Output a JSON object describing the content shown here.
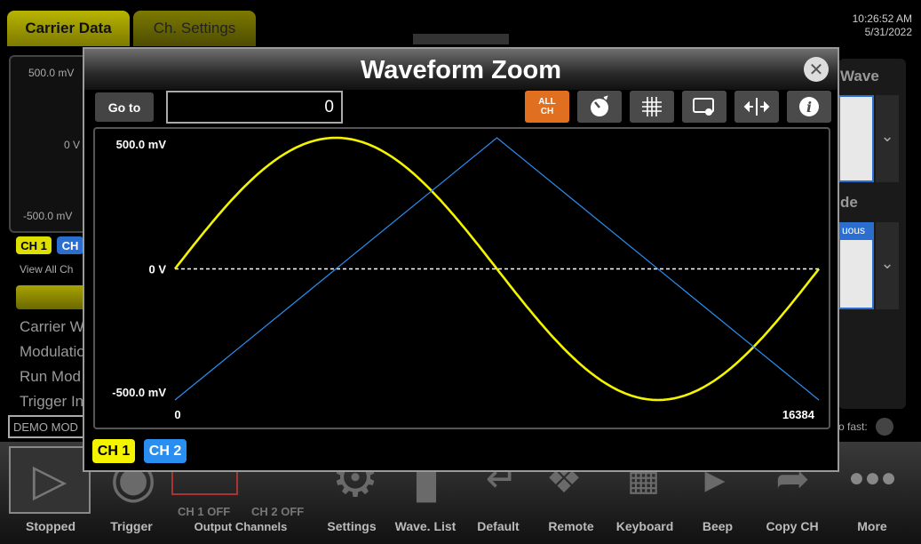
{
  "app": {
    "tabs": [
      "Carrier Data",
      "Ch. Settings"
    ],
    "clock_time": "10:26:52 AM",
    "clock_date": "5/31/2022",
    "left_panel": {
      "top_label": "500.0 mV",
      "mid_label": "0 V",
      "bottom_label": "-500.0 mV"
    },
    "left_chips": [
      "CH 1",
      "CH"
    ],
    "view_all": "View All Ch",
    "menu_items": [
      "Carrier W",
      "Modulatio",
      "Run Mod",
      "Trigger In"
    ],
    "demo_mode": "DEMO MOD",
    "right_labels": {
      "wave": "Wave",
      "mode": "de",
      "mode_value": "uous",
      "auto_fast": "o fast:"
    },
    "toolbar": {
      "labels": [
        "Stopped",
        "Trigger",
        "Output Channels",
        "Settings",
        "Wave. List",
        "Default",
        "Remote",
        "Keyboard",
        "Beep",
        "Copy CH",
        "More"
      ],
      "ch1_off": "CH 1 OFF",
      "ch2_off": "CH 2 OFF"
    }
  },
  "modal": {
    "title": "Waveform Zoom",
    "goto_label": "Go to",
    "goto_value": "0",
    "all_ch_line1": "ALL",
    "all_ch_line2": "CH",
    "icons": [
      "speed-dial-icon",
      "grid-icon",
      "touch-select-icon",
      "pan-horizontal-icon",
      "info-icon"
    ],
    "channels": [
      "CH 1",
      "CH 2"
    ],
    "colors": {
      "ch1": "#f4f400",
      "ch2": "#2a8ef0",
      "all_ch": "#e07020"
    }
  },
  "chart_data": {
    "type": "line",
    "y_labels": {
      "top": "500.0 mV",
      "zero": "0 V",
      "bottom": "-500.0 mV"
    },
    "x_labels": {
      "start": "0",
      "end": "16384"
    },
    "xlim": [
      0,
      16384
    ],
    "ylim": [
      -500,
      500
    ],
    "zero_line": "dashed",
    "series": [
      {
        "name": "CH 1",
        "color": "#f4f400",
        "shape": "sine",
        "x": [
          0,
          4096,
          8192,
          12288,
          16384
        ],
        "y": [
          0,
          500,
          0,
          -500,
          0
        ]
      },
      {
        "name": "CH 2",
        "color": "#2a8ef0",
        "shape": "triangle",
        "x": [
          0,
          8192,
          16384
        ],
        "y": [
          -500,
          500,
          -500
        ]
      }
    ]
  }
}
